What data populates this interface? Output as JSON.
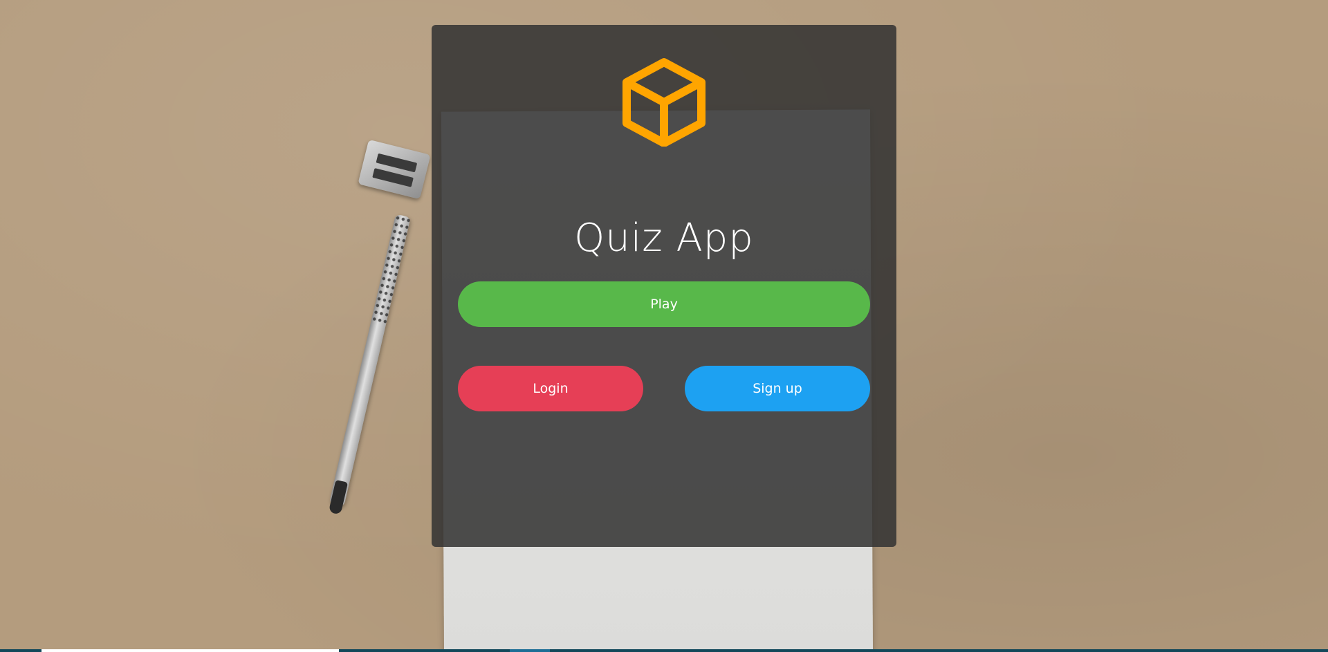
{
  "app": {
    "title": "Quiz App"
  },
  "buttons": {
    "play_label": "Play",
    "login_label": "Login",
    "signup_label": "Sign up"
  },
  "icons": {
    "logo": "cube-icon"
  },
  "colors": {
    "logo_orange": "#ffa500",
    "play_green": "#58b84a",
    "login_red": "#e63f56",
    "signup_blue": "#1da1f2",
    "panel_dark": "#3c3c3c"
  }
}
